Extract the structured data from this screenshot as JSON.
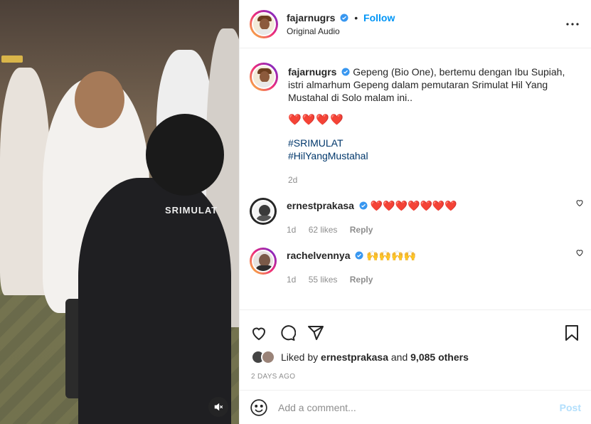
{
  "header": {
    "username": "fajarnugrs",
    "separator": "•",
    "follow_label": "Follow",
    "subtitle": "Original Audio"
  },
  "media": {
    "jacket_text": "SRIMULAT",
    "mute_icon": "speaker-muted-icon"
  },
  "caption": {
    "username": "fajarnugrs",
    "text": "Gepeng (Bio One), bertemu dengan Ibu Supiah, istri almarhum Gepeng dalam pemutaran Srimulat Hil Yang Mustahal di Solo malam ini..",
    "hearts": "❤️❤️❤️❤️",
    "hashtags": [
      "#SRIMULAT",
      "#HilYangMustahal"
    ],
    "age": "2d"
  },
  "comments": [
    {
      "username": "ernestprakasa",
      "text": "❤️❤️❤️❤️❤️❤️❤️",
      "age": "1d",
      "likes": "62 likes",
      "reply": "Reply"
    },
    {
      "username": "rachelvennya",
      "text": "🙌🙌🙌🙌",
      "age": "1d",
      "likes": "55 likes",
      "reply": "Reply"
    }
  ],
  "actions": {
    "liked_by_prefix": "Liked by",
    "liked_by_user": "ernestprakasa",
    "liked_by_and": "and",
    "others": "9,085 others",
    "timestamp": "2 DAYS AGO"
  },
  "add_comment": {
    "placeholder": "Add a comment...",
    "post_label": "Post"
  },
  "colors": {
    "accent": "#0095f6",
    "hashtag": "#00376b",
    "muted": "#8e8e8e",
    "post_disabled": "#b2dffc",
    "verified": "#3897f0"
  }
}
